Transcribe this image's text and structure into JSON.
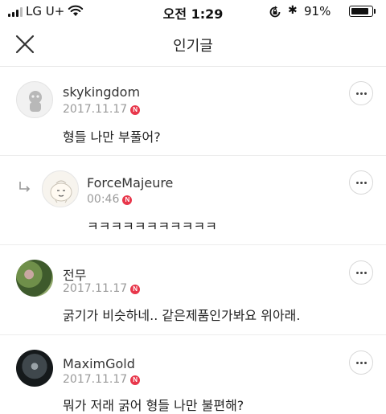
{
  "status_bar": {
    "carrier": "LG U+",
    "time": "오전 1:29",
    "battery": "91%",
    "battery_level": 0.91
  },
  "header": {
    "title": "인기글"
  },
  "comments": [
    {
      "username": "skykingdom",
      "date": "2017.11.17",
      "badge": "N",
      "body": "형들 나만 부풀어?",
      "is_reply": false
    },
    {
      "username": "ForceMajeure",
      "date": "00:46",
      "badge": "N",
      "body": "ㅋㅋㅋㅋㅋㅋㅋㅋㅋㅋㅋ",
      "is_reply": true
    },
    {
      "username": "전무",
      "date": "2017.11.17",
      "badge": "N",
      "body": "굵기가 비슷하네.. 같은제품인가봐요 위아래.",
      "is_reply": false
    },
    {
      "username": "MaximGold",
      "date": "2017.11.17",
      "badge": "N",
      "body": "뭐가 저래 굵어 형들 나만 불편해?",
      "is_reply": false
    }
  ],
  "icons": {
    "close": "close-icon",
    "more": "more-icon",
    "reply": "reply-arrow-icon",
    "new_badge_color": "#e8374b"
  }
}
